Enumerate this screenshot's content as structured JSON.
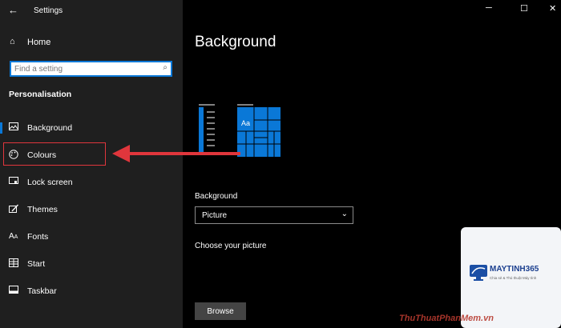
{
  "window": {
    "title": "Settings",
    "back_icon": "arrow-left-icon",
    "controls": {
      "minimize": "─",
      "maximize": "☐",
      "close": "✕"
    }
  },
  "sidebar": {
    "home": {
      "label": "Home",
      "icon": "home-icon"
    },
    "search": {
      "placeholder": "Find a setting",
      "icon": "search-icon"
    },
    "section_title": "Personalisation",
    "items": [
      {
        "label": "Background",
        "icon": "picture-icon",
        "active": true
      },
      {
        "label": "Colours",
        "icon": "palette-icon",
        "active": false
      },
      {
        "label": "Lock screen",
        "icon": "lock-screen-icon",
        "active": false
      },
      {
        "label": "Themes",
        "icon": "brush-icon",
        "active": false
      },
      {
        "label": "Fonts",
        "icon": "font-icon",
        "active": false
      },
      {
        "label": "Start",
        "icon": "start-tiles-icon",
        "active": false
      },
      {
        "label": "Taskbar",
        "icon": "taskbar-icon",
        "active": false
      }
    ]
  },
  "main": {
    "title": "Background",
    "preview": {
      "tile_text": "Aa"
    },
    "background_label": "Background",
    "background_value": "Picture",
    "choose_label": "Choose your picture",
    "browse_label": "Browse"
  },
  "annotation": {
    "highlight_color": "#e0363c"
  },
  "watermark": {
    "brand": "MAYTINH365",
    "tagline": "Chia sẻ & Thủ thuật Máy tính",
    "bottom": "ThuThuatPhanMem.vn"
  },
  "colors": {
    "accent": "#0a78d7",
    "sidebar_bg": "#1f1f1f",
    "main_bg": "#000000"
  }
}
